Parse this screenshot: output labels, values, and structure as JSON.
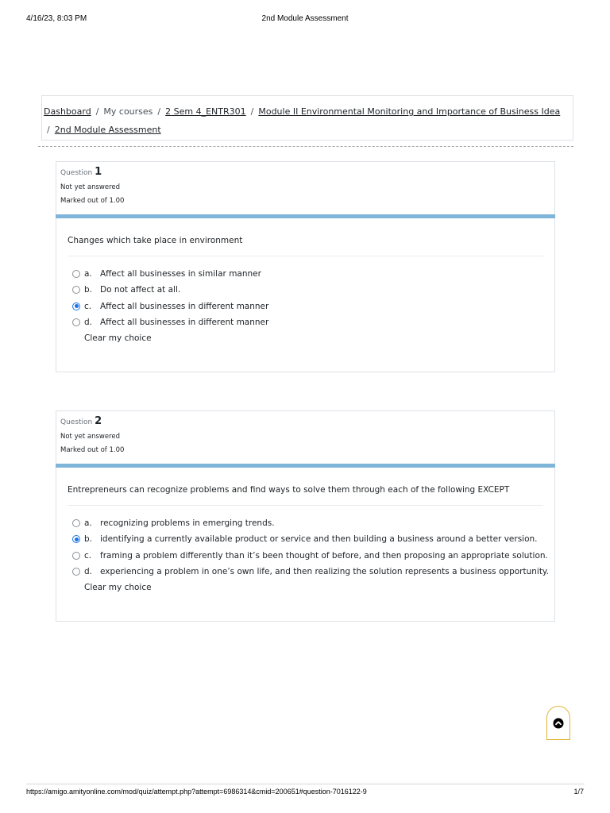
{
  "print_header": {
    "datetime": "4/16/23, 8:03 PM",
    "title": "2nd Module Assessment"
  },
  "breadcrumb": {
    "dashboard": "Dashboard",
    "my_courses": "My courses",
    "course": "2 Sem 4_ENTR301",
    "module": "Module II Environmental Monitoring and Importance of Business Idea",
    "current": "2nd Module Assessment",
    "separator": "/"
  },
  "questions": [
    {
      "label": "Question",
      "number": "1",
      "state": "Not yet answered",
      "grade": "Marked out of 1.00",
      "text": "Changes which take place in environment",
      "answers": [
        {
          "letter": "a.",
          "text": "Affect all businesses in similar manner",
          "selected": false
        },
        {
          "letter": "b.",
          "text": "Do not affect at all.",
          "selected": false
        },
        {
          "letter": "c.",
          "text": "Affect all businesses in different manner",
          "selected": true
        },
        {
          "letter": "d.",
          "text": "Affect all businesses in different manner",
          "selected": false
        }
      ],
      "clear_label": "Clear my choice"
    },
    {
      "label": "Question",
      "number": "2",
      "state": "Not yet answered",
      "grade": "Marked out of 1.00",
      "text": "Entrepreneurs can recognize problems and find ways to solve them through each of the following EXCEPT",
      "answers": [
        {
          "letter": "a.",
          "text": "recognizing problems in emerging trends.",
          "selected": false
        },
        {
          "letter": "b.",
          "text": "identifying a currently available product or service and then building a business around a better version.",
          "selected": true
        },
        {
          "letter": "c.",
          "text": "framing a problem differently than it’s been thought of before, and then proposing an appropriate solution.",
          "selected": false
        },
        {
          "letter": "d.",
          "text": "experiencing a problem in one’s own life, and then realizing the solution represents a business opportunity.",
          "selected": false
        }
      ],
      "clear_label": "Clear my choice"
    }
  ],
  "back_to_top_icon": "arrow-up-circle-icon",
  "print_footer": {
    "url": "https://amigo.amityonline.com/mod/quiz/attempt.php?attempt=6986314&cmid=200651#question-7016122-9",
    "page": "1/7"
  },
  "colors": {
    "accent_bar": "#7eb5d8",
    "radio_selected": "#1a73e8",
    "back_to_top_border": "#e0b53a"
  }
}
